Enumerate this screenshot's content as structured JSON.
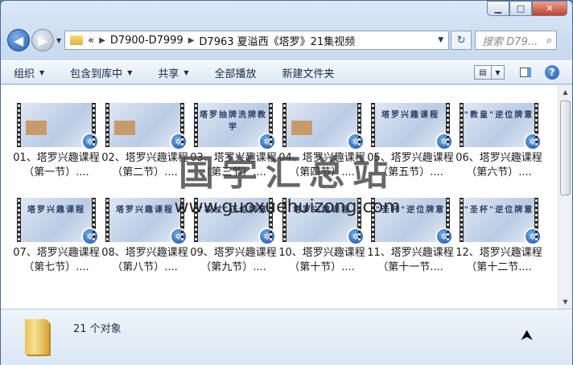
{
  "window": {
    "minimize": "▁",
    "maximize": "□",
    "close": "✕"
  },
  "nav": {
    "back_icon": "◀",
    "forward_icon": "▶",
    "recent_icon": "▼",
    "breadcrumb_prefix": "«",
    "crumbs": [
      "D7900-D7999",
      "D7963 夏溢西《塔罗》21集视频"
    ],
    "refresh_icon": "↻",
    "search_placeholder": "搜索 D79...",
    "search_icon": "⌕"
  },
  "toolbar": {
    "organize": "组织",
    "include_library": "包含到库中",
    "share": "共享",
    "play_all": "全部播放",
    "new_folder": "新建文件夹",
    "help_icon": "?"
  },
  "files": [
    {
      "name": "01、塔罗兴趣课程（第一节）....",
      "slide_title": ""
    },
    {
      "name": "02、塔罗兴趣课程（第二节）....",
      "slide_title": ""
    },
    {
      "name": "03、塔罗兴趣课程（第三节）....",
      "slide_title": "塔罗抽牌洗牌教学"
    },
    {
      "name": "04、塔罗兴趣课程（第四节）....",
      "slide_title": ""
    },
    {
      "name": "05、塔罗兴趣课程（第五节）....",
      "slide_title": "塔罗兴趣课程"
    },
    {
      "name": "06、塔罗兴趣课程（第六节）....",
      "slide_title": "\"教皇\"逆位牌意"
    },
    {
      "name": "07、塔罗兴趣课程（第七节）....",
      "slide_title": "塔罗兴趣课程"
    },
    {
      "name": "08、塔罗兴趣课程（第八节）....",
      "slide_title": "塔罗兴趣课程"
    },
    {
      "name": "09、塔罗兴趣课程（第九节）....",
      "slide_title": "\"权杖\"正位牌意"
    },
    {
      "name": "10、塔罗兴趣课程（第十节）....",
      "slide_title": "塔罗兴趣课程"
    },
    {
      "name": "11、塔罗兴趣课程（第十一节....",
      "slide_title": "\"圣杯\"逆位牌意"
    },
    {
      "name": "12、塔罗兴趣课程（第十二节....",
      "slide_title": "\"圣杯\"逆位牌意"
    }
  ],
  "status": {
    "count": "21 个对象"
  },
  "watermark": {
    "cn": "国学汇总站",
    "url": "www.guoxuehuizong.com"
  }
}
